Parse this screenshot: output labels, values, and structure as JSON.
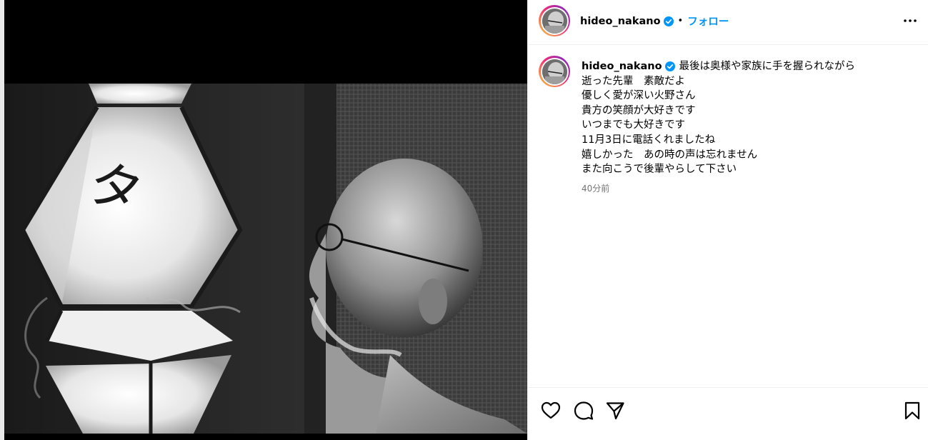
{
  "post": {
    "username": "hideo_nakano",
    "verified": true,
    "separator": "•",
    "follow_label": "フォロー",
    "more_icon": "more-horizontal-icon"
  },
  "caption": {
    "username": "hideo_nakano",
    "lines": [
      "最後は奥様や家族に手を握られながら",
      "逝った先輩　素敵だよ",
      "優しく愛が深い火野さん",
      "貴方の笑顔が大好きです",
      "いつまでも大好きです",
      "11月3日に電話くれましたね",
      "嬉しかった　あの時の声は忘れません",
      "また向こうで後輩やらして下さい"
    ],
    "timestamp": "40分前"
  },
  "actions": {
    "like_icon": "heart-icon",
    "comment_icon": "comment-icon",
    "share_icon": "share-icon",
    "save_icon": "bookmark-icon"
  },
  "colors": {
    "follow": "#0095f6",
    "verified": "#0095f6",
    "timestamp": "#737373",
    "divider": "#efefef"
  }
}
